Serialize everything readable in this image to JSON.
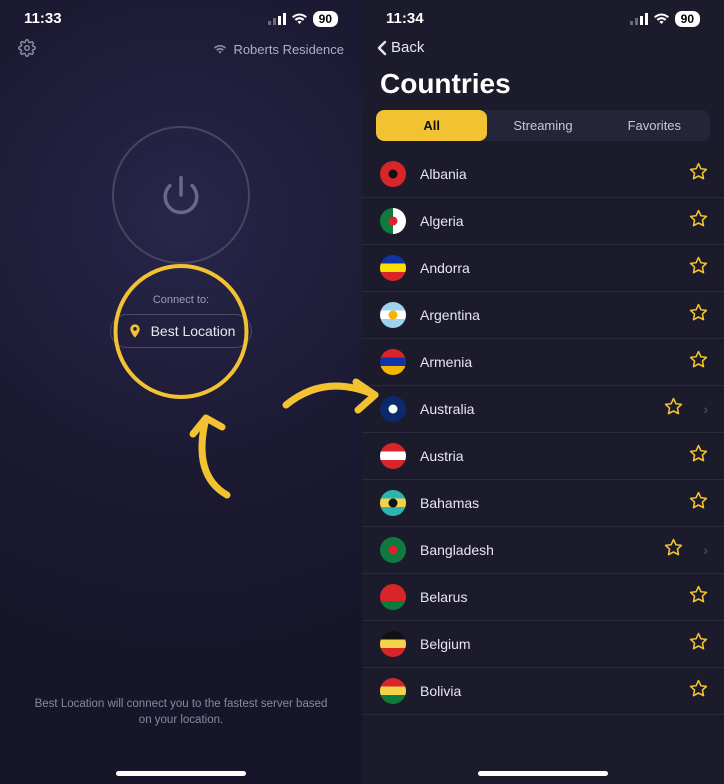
{
  "left": {
    "status_time": "11:33",
    "battery": "90",
    "network_name": "Roberts Residence",
    "connect_label": "Connect to:",
    "best_location": "Best Location",
    "hint": "Best Location will connect you to the fastest server based on your location."
  },
  "right": {
    "status_time": "11:34",
    "battery": "90",
    "back": "Back",
    "title": "Countries",
    "tabs": {
      "all": "All",
      "streaming": "Streaming",
      "favorites": "Favorites"
    },
    "countries": [
      {
        "name": "Albania",
        "flag_colors": [
          "#d8252a",
          "#d8252a"
        ],
        "emblem": "#111",
        "has_chevron": false
      },
      {
        "name": "Algeria",
        "flag_colors": [
          "#0f7a3d",
          "#ffffff"
        ],
        "emblem": "#d8252a",
        "has_chevron": false
      },
      {
        "name": "Andorra",
        "flag_colors": [
          "#1034a6",
          "#fedd00",
          "#d8252a"
        ],
        "emblem": null,
        "has_chevron": false
      },
      {
        "name": "Argentina",
        "flag_colors": [
          "#9fd2ec",
          "#ffffff",
          "#9fd2ec"
        ],
        "emblem": "#f4b400",
        "has_chevron": false
      },
      {
        "name": "Armenia",
        "flag_colors": [
          "#d8252a",
          "#1034a6",
          "#f4b400"
        ],
        "emblem": null,
        "has_chevron": false
      },
      {
        "name": "Australia",
        "flag_colors": [
          "#0a2a6b",
          "#0a2a6b"
        ],
        "emblem": "#ffffff",
        "has_chevron": true
      },
      {
        "name": "Austria",
        "flag_colors": [
          "#d8252a",
          "#ffffff",
          "#d8252a"
        ],
        "emblem": null,
        "has_chevron": false
      },
      {
        "name": "Bahamas",
        "flag_colors": [
          "#2cb4b0",
          "#f4d24a",
          "#2cb4b0"
        ],
        "emblem": "#111",
        "has_chevron": false
      },
      {
        "name": "Bangladesh",
        "flag_colors": [
          "#0f7a3d",
          "#0f7a3d"
        ],
        "emblem": "#d8252a",
        "has_chevron": true
      },
      {
        "name": "Belarus",
        "flag_colors": [
          "#d8252a",
          "#d8252a",
          "#0f7a3d"
        ],
        "emblem": null,
        "has_chevron": false
      },
      {
        "name": "Belgium",
        "flag_colors": [
          "#111111",
          "#f4d24a",
          "#d8252a"
        ],
        "emblem": null,
        "has_chevron": false
      },
      {
        "name": "Bolivia",
        "flag_colors": [
          "#d8252a",
          "#f4d24a",
          "#0f7a3d"
        ],
        "emblem": null,
        "has_chevron": false
      }
    ]
  },
  "colors": {
    "accent": "#f2c233"
  }
}
